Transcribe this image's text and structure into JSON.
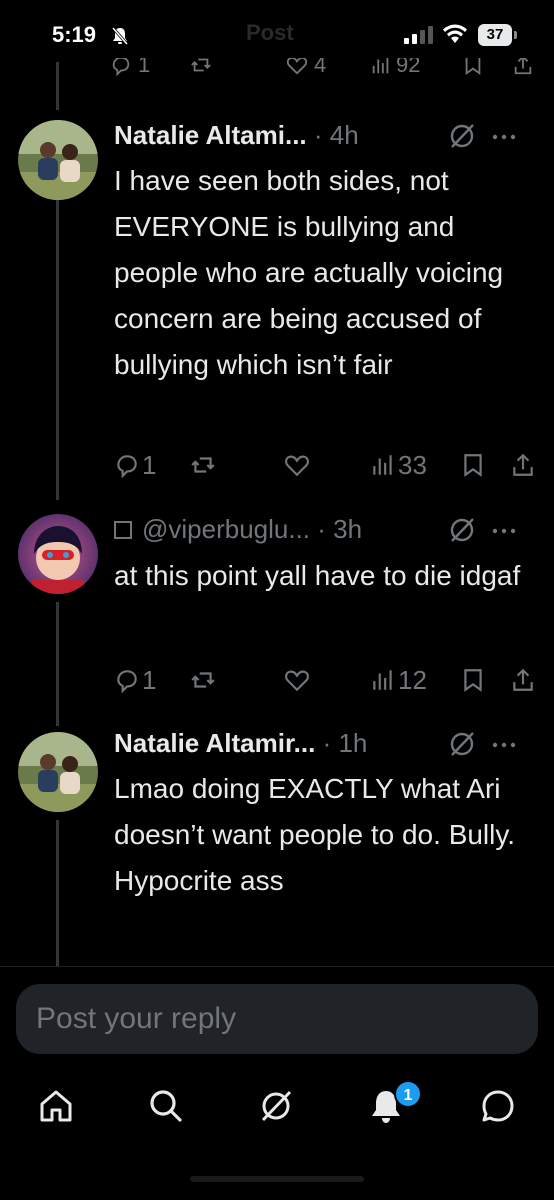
{
  "status_bar": {
    "time": "5:19",
    "battery": "37",
    "header_title": "Post"
  },
  "top_partial_actions": {
    "replies": "1",
    "likes": "4",
    "views": "92"
  },
  "tweets": [
    {
      "name": "Natalie Altami...",
      "time": "4h",
      "text": "I have seen both sides, not EVERYONE is bullying and people who are actually voicing concern are being accused of bullying which isn’t fair",
      "replies": "1",
      "views": "33"
    },
    {
      "handle": "@viperbuglu...",
      "time": "3h",
      "text": "at this point yall have to die idgaf",
      "replies": "1",
      "views": "12"
    },
    {
      "name": "Natalie Altamir...",
      "time": "1h",
      "text": "Lmao doing EXACTLY what Ari doesn’t want people to do. Bully. Hypocrite ass"
    }
  ],
  "reply": {
    "placeholder": "Post your reply"
  },
  "nav": {
    "items": [
      "home-icon",
      "search-icon",
      "grok-icon",
      "notifications-icon",
      "messages-icon"
    ],
    "notifications_badge": "1"
  },
  "colors": {
    "background": "#000000",
    "text": "#e7e9ea",
    "muted": "#71767b",
    "accent": "#1d9bf0",
    "reply_box": "#202327"
  }
}
